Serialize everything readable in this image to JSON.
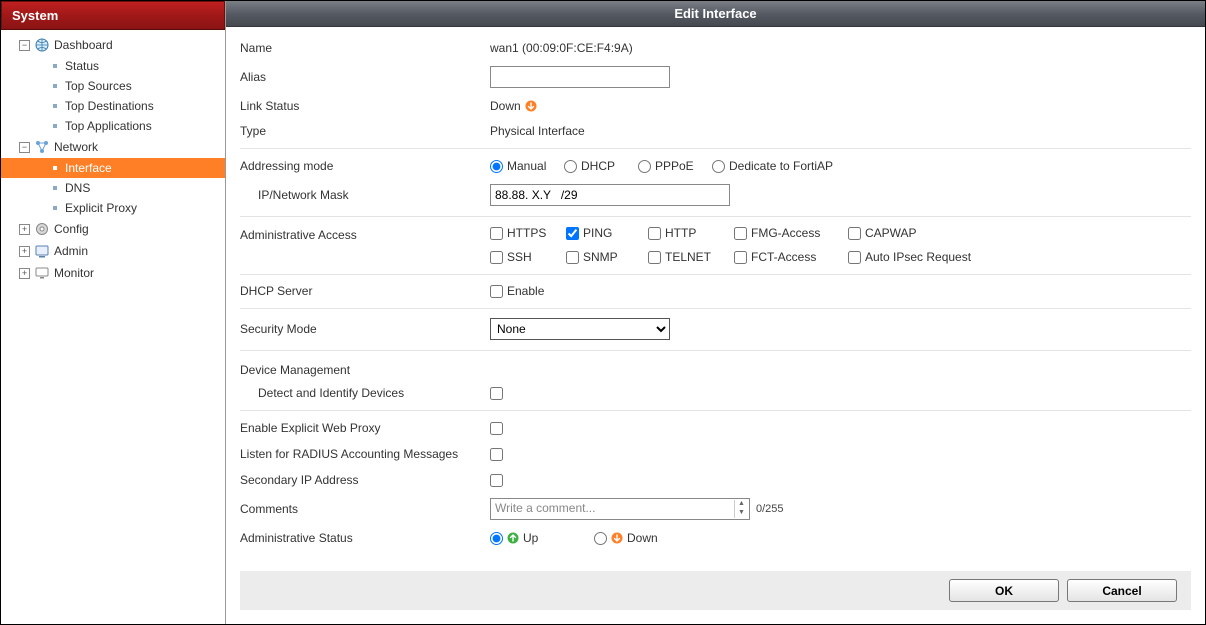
{
  "sidebar": {
    "title": "System",
    "nodes": {
      "dashboard": {
        "label": "Dashboard"
      },
      "status": {
        "label": "Status"
      },
      "top_sources": {
        "label": "Top Sources"
      },
      "top_destinations": {
        "label": "Top Destinations"
      },
      "top_applications": {
        "label": "Top Applications"
      },
      "network": {
        "label": "Network"
      },
      "interface": {
        "label": "Interface"
      },
      "dns": {
        "label": "DNS"
      },
      "explicit_proxy": {
        "label": "Explicit Proxy"
      },
      "config": {
        "label": "Config"
      },
      "admin": {
        "label": "Admin"
      },
      "monitor": {
        "label": "Monitor"
      }
    }
  },
  "header": {
    "title": "Edit Interface"
  },
  "form": {
    "name_label": "Name",
    "name_value": "wan1 (00:09:0F:CE:F4:9A)",
    "alias_label": "Alias",
    "alias_value": "",
    "link_status_label": "Link Status",
    "link_status_value": "Down",
    "type_label": "Type",
    "type_value": "Physical Interface",
    "addressing_mode_label": "Addressing mode",
    "addressing_modes": {
      "manual": "Manual",
      "dhcp": "DHCP",
      "pppoe": "PPPoE",
      "fortiap": "Dedicate to FortiAP"
    },
    "ip_mask_label": "IP/Network Mask",
    "ip_mask_value": "88.88. X.Y   /29",
    "admin_access_label": "Administrative Access",
    "admin_access": {
      "https": "HTTPS",
      "ping": "PING",
      "http": "HTTP",
      "fmg": "FMG-Access",
      "capwap": "CAPWAP",
      "ssh": "SSH",
      "snmp": "SNMP",
      "telnet": "TELNET",
      "fct": "FCT-Access",
      "autoipsec": "Auto IPsec Request"
    },
    "dhcp_server_label": "DHCP Server",
    "dhcp_enable_label": "Enable",
    "security_mode_label": "Security Mode",
    "security_mode_value": "None",
    "device_mgmt_label": "Device Management",
    "detect_devices_label": "Detect and Identify Devices",
    "explicit_proxy_label": "Enable Explicit Web Proxy",
    "radius_label": "Listen for RADIUS Accounting Messages",
    "secondary_ip_label": "Secondary IP Address",
    "comments_label": "Comments",
    "comments_placeholder": "Write a comment...",
    "comments_counter": "0/255",
    "admin_status_label": "Administrative Status",
    "admin_status": {
      "up": "Up",
      "down": "Down"
    }
  },
  "buttons": {
    "ok": "OK",
    "cancel": "Cancel"
  }
}
